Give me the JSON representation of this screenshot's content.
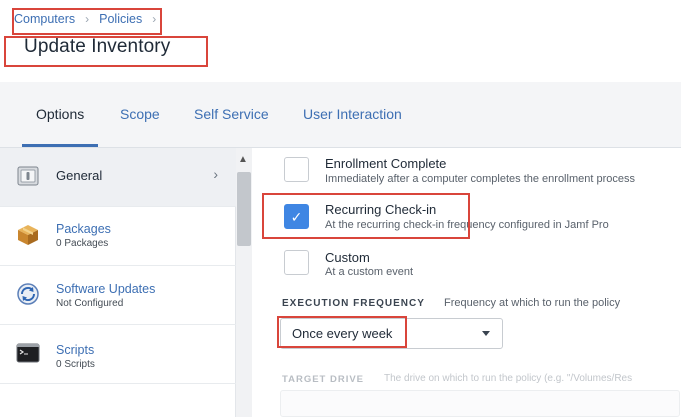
{
  "breadcrumb": {
    "items": [
      "Computers",
      "Policies"
    ],
    "trailing_chevron": "›"
  },
  "page": {
    "title": "Update Inventory"
  },
  "tabs": [
    {
      "label": "Options",
      "active": true
    },
    {
      "label": "Scope",
      "active": false
    },
    {
      "label": "Self Service",
      "active": false
    },
    {
      "label": "User Interaction",
      "active": false
    }
  ],
  "sidebar": {
    "items": [
      {
        "title": "General",
        "subtitle": "",
        "icon": "general-icon",
        "active": true
      },
      {
        "title": "Packages",
        "subtitle": "0 Packages",
        "icon": "package-icon",
        "active": false
      },
      {
        "title": "Software Updates",
        "subtitle": "Not Configured",
        "icon": "software-update-icon",
        "active": false
      },
      {
        "title": "Scripts",
        "subtitle": "0 Scripts",
        "icon": "terminal-icon",
        "active": false
      }
    ]
  },
  "triggers": [
    {
      "title": "Enrollment Complete",
      "description": "Immediately after a computer completes the enrollment process",
      "checked": false
    },
    {
      "title": "Recurring Check-in",
      "description": "At the recurring check-in frequency configured in Jamf Pro",
      "checked": true
    },
    {
      "title": "Custom",
      "description": "At a custom event",
      "checked": false
    }
  ],
  "execution_frequency": {
    "label": "EXECUTION FREQUENCY",
    "description": "Frequency at which to run the policy",
    "selected": "Once every week"
  },
  "target_drive": {
    "label": "TARGET DRIVE",
    "description": "The drive on which to run the policy (e.g. \"/Volumes/Res"
  },
  "colors": {
    "accent": "#3d6fb3",
    "checkbox": "#3f86e3",
    "highlight": "#d9453b"
  }
}
